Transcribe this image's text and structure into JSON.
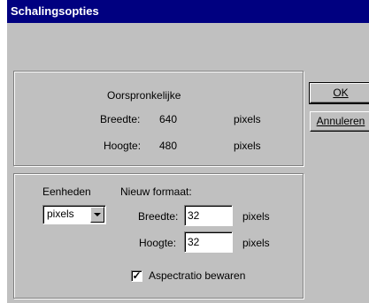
{
  "window": {
    "title": "Schalingsopties"
  },
  "original": {
    "heading": "Oorspronkelijke",
    "width_label": "Breedte:",
    "width_value": "640",
    "width_unit": "pixels",
    "height_label": "Hoogte:",
    "height_value": "480",
    "height_unit": "pixels"
  },
  "new_size": {
    "units_label": "Eenheden",
    "units_selected": "pixels",
    "heading": "Nieuw formaat:",
    "width_label": "Breedte:",
    "width_value": "32",
    "width_unit": "pixels",
    "height_label": "Hoogte:",
    "height_value": "32",
    "height_unit": "pixels",
    "aspect_label": "Aspectratio bewaren",
    "aspect_checked": true,
    "aspect_mark": "✓"
  },
  "buttons": {
    "ok": "OK",
    "cancel": "Annuleren"
  }
}
